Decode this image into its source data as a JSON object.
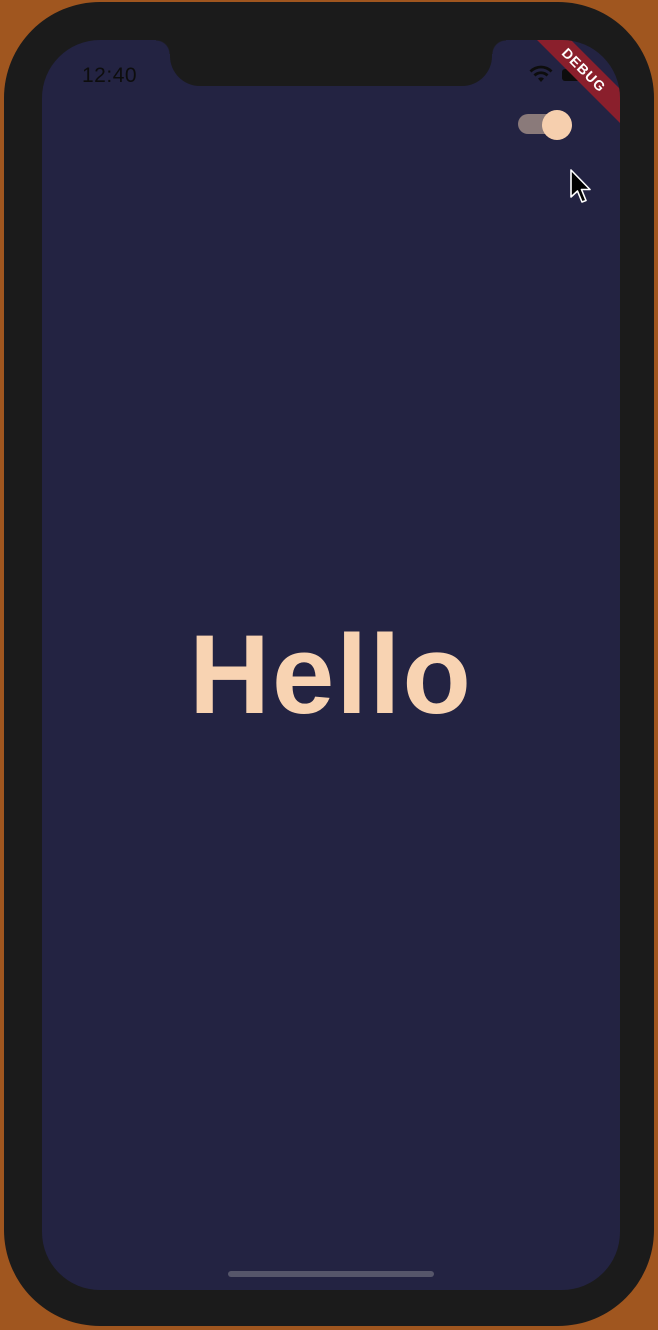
{
  "status_bar": {
    "time": "12:40",
    "icons": [
      "wifi-icon",
      "battery-icon"
    ]
  },
  "debug_banner": {
    "label": "DEBUG",
    "color": "#8a1f2c"
  },
  "theme_toggle": {
    "state": "on",
    "track_color": "#8a7a7a",
    "thumb_color": "#f6cfae"
  },
  "main": {
    "greeting": "Hello",
    "text_color": "#f8d3b2",
    "background": "#232342"
  }
}
